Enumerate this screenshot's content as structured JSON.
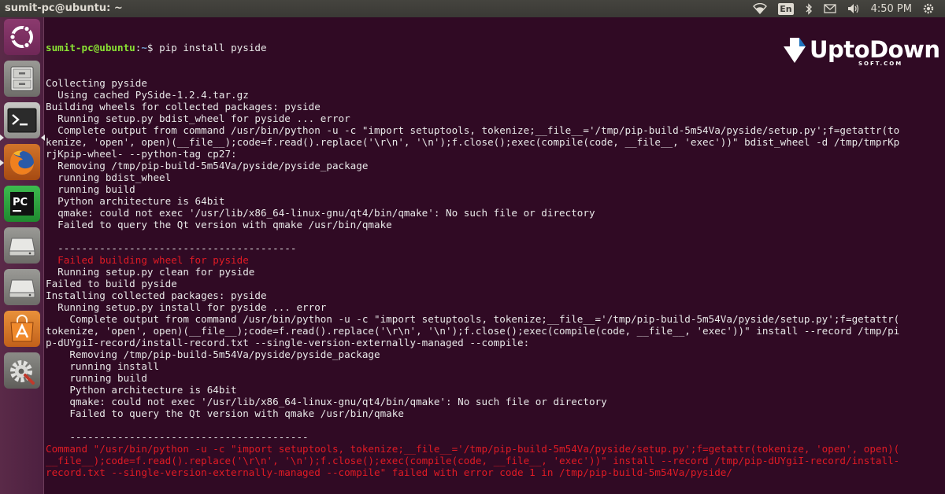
{
  "window": {
    "title": "sumit-pc@ubuntu: ~"
  },
  "tray": {
    "icons": [
      "wifi-icon",
      "keyboard-layout",
      "bluetooth-icon",
      "mail-icon",
      "volume-icon",
      "power-gear-icon"
    ],
    "keyboard": "En",
    "clock": "4:50 PM"
  },
  "launcher": {
    "items": [
      "dash-home",
      "files",
      "terminal",
      "firefox",
      "pycharm",
      "drive-1",
      "drive-2",
      "software-center",
      "system-settings"
    ]
  },
  "watermark": {
    "brand": "UptoDown",
    "sub": "SOFT.COM"
  },
  "terminal": {
    "prompt_user": "sumit-pc@ubuntu",
    "prompt_path": "~",
    "prompt_symbol": "$",
    "command": " pip install pyside",
    "lines": [
      {
        "t": "Collecting pyside",
        "c": ""
      },
      {
        "t": "  Using cached PySide-1.2.4.tar.gz",
        "c": ""
      },
      {
        "t": "Building wheels for collected packages: pyside",
        "c": ""
      },
      {
        "t": "  Running setup.py bdist_wheel for pyside ... error",
        "c": ""
      },
      {
        "t": "  Complete output from command /usr/bin/python -u -c \"import setuptools, tokenize;__file__='/tmp/pip-build-5m54Va/pyside/setup.py';f=getattr(to",
        "c": ""
      },
      {
        "t": "kenize, 'open', open)(__file__);code=f.read().replace('\\r\\n', '\\n');f.close();exec(compile(code, __file__, 'exec'))\" bdist_wheel -d /tmp/tmprKp",
        "c": ""
      },
      {
        "t": "rjKpip-wheel- --python-tag cp27:",
        "c": ""
      },
      {
        "t": "  Removing /tmp/pip-build-5m54Va/pyside/pyside_package",
        "c": ""
      },
      {
        "t": "  running bdist_wheel",
        "c": ""
      },
      {
        "t": "  running build",
        "c": ""
      },
      {
        "t": "  Python architecture is 64bit",
        "c": ""
      },
      {
        "t": "  qmake: could not exec '/usr/lib/x86_64-linux-gnu/qt4/bin/qmake': No such file or directory",
        "c": ""
      },
      {
        "t": "  Failed to query the Qt version with qmake /usr/bin/qmake",
        "c": ""
      },
      {
        "t": "",
        "c": ""
      },
      {
        "t": "  ----------------------------------------",
        "c": ""
      },
      {
        "t": "  Failed building wheel for pyside",
        "c": "red"
      },
      {
        "t": "  Running setup.py clean for pyside",
        "c": ""
      },
      {
        "t": "Failed to build pyside",
        "c": ""
      },
      {
        "t": "Installing collected packages: pyside",
        "c": ""
      },
      {
        "t": "  Running setup.py install for pyside ... error",
        "c": ""
      },
      {
        "t": "    Complete output from command /usr/bin/python -u -c \"import setuptools, tokenize;__file__='/tmp/pip-build-5m54Va/pyside/setup.py';f=getattr(",
        "c": ""
      },
      {
        "t": "tokenize, 'open', open)(__file__);code=f.read().replace('\\r\\n', '\\n');f.close();exec(compile(code, __file__, 'exec'))\" install --record /tmp/pi",
        "c": ""
      },
      {
        "t": "p-dUYgiI-record/install-record.txt --single-version-externally-managed --compile:",
        "c": ""
      },
      {
        "t": "    Removing /tmp/pip-build-5m54Va/pyside/pyside_package",
        "c": ""
      },
      {
        "t": "    running install",
        "c": ""
      },
      {
        "t": "    running build",
        "c": ""
      },
      {
        "t": "    Python architecture is 64bit",
        "c": ""
      },
      {
        "t": "    qmake: could not exec '/usr/lib/x86_64-linux-gnu/qt4/bin/qmake': No such file or directory",
        "c": ""
      },
      {
        "t": "    Failed to query the Qt version with qmake /usr/bin/qmake",
        "c": ""
      },
      {
        "t": "",
        "c": ""
      },
      {
        "t": "    ----------------------------------------",
        "c": ""
      },
      {
        "t": "Command \"/usr/bin/python -u -c \"import setuptools, tokenize;__file__='/tmp/pip-build-5m54Va/pyside/setup.py';f=getattr(tokenize, 'open', open)(",
        "c": "red"
      },
      {
        "t": "__file__);code=f.read().replace('\\r\\n', '\\n');f.close();exec(compile(code, __file__, 'exec'))\" install --record /tmp/pip-dUYgiI-record/install-",
        "c": "red"
      },
      {
        "t": "record.txt --single-version-externally-managed --compile\" failed with error code 1 in /tmp/pip-build-5m54Va/pyside/",
        "c": "red"
      }
    ]
  }
}
